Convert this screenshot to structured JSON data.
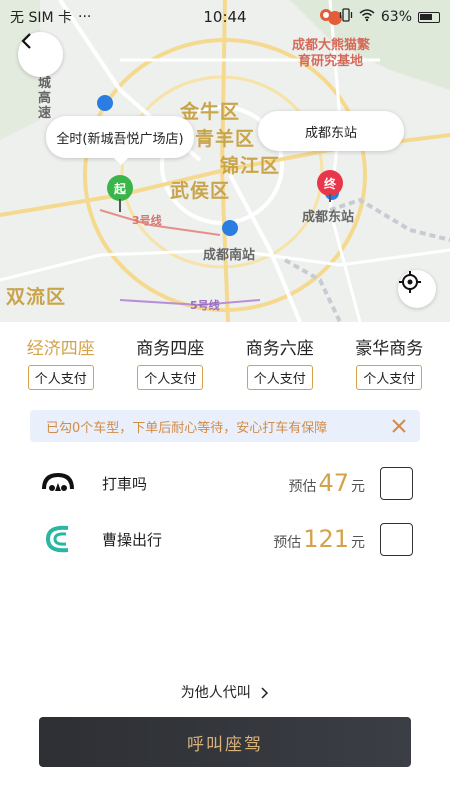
{
  "status_bar": {
    "carrier": "无 SIM 卡",
    "more": "···",
    "time": "10:44",
    "battery": "63%",
    "icons": [
      "app-icon",
      "vibrate-icon",
      "wifi-icon",
      "battery-icon"
    ]
  },
  "map": {
    "districts": [
      "金牛区",
      "青羊区",
      "锦江区",
      "武侯区",
      "双流区",
      "城",
      "高",
      "速"
    ],
    "pois": [
      "成都大熊猫繁",
      "育研究基地",
      "成都东站",
      "成都南站"
    ],
    "lines": [
      "3号线",
      "5号线"
    ],
    "start_bubble": "全时(新城吾悦广场店)",
    "end_bubble": "成都东站",
    "start_pin": "起",
    "end_pin": "终"
  },
  "car_classes": [
    {
      "name": "经济四座",
      "pay": "个人支付",
      "active": true
    },
    {
      "name": "商务四座",
      "pay": "个人支付",
      "active": false
    },
    {
      "name": "商务六座",
      "pay": "个人支付",
      "active": false
    },
    {
      "name": "豪华商务",
      "pay": "个人支付",
      "active": false
    }
  ],
  "notice": {
    "text": "已勾0个车型，下单后耐心等待，安心打车有保障"
  },
  "providers": [
    {
      "name": "打車吗",
      "price_prefix": "预估",
      "price": "47",
      "unit": "元",
      "logo": "dachema-logo-icon",
      "checked": false
    },
    {
      "name": "曹操出行",
      "price_prefix": "预估",
      "price": "121",
      "unit": "元",
      "logo": "caocao-logo-icon",
      "checked": false
    }
  ],
  "call_for_others": "为他人代叫",
  "call_button": "呼叫座驾",
  "colors": {
    "accent": "#d4a24a",
    "notice_bg": "#e9f0fb",
    "notice_text": "#d18c48",
    "button_bg": "#2d2f34",
    "button_text": "#d8b27a",
    "start_pin": "#3ab54a",
    "end_pin": "#e8364a"
  }
}
